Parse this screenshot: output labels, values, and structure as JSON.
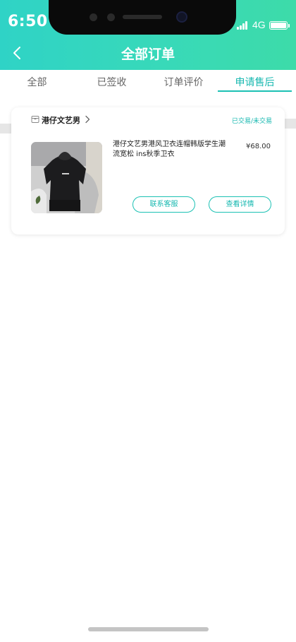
{
  "status_bar": {
    "time": "6:50",
    "network": "4G"
  },
  "header": {
    "title": "全部订单"
  },
  "tabs": [
    {
      "label": "全部",
      "active": false
    },
    {
      "label": "已签收",
      "active": false
    },
    {
      "label": "订单评价",
      "active": false
    },
    {
      "label": "申请售后",
      "active": true
    }
  ],
  "order": {
    "shop_name": "港仔文艺男",
    "trade_status": "已交易/未交易",
    "product_title": "港仔文艺男港风卫衣连帽韩版学生潮流宽松 ins秋季卫衣",
    "price": "¥68.00",
    "contact_label": "联系客服",
    "detail_label": "查看详情"
  },
  "colors": {
    "header_gradient_start": "#2fd3c6",
    "header_gradient_end": "#3ddba9",
    "accent": "#17b8b0"
  },
  "icons": {
    "back": "chevron-left-icon",
    "shop": "store-icon",
    "shop_link": "chevron-right-icon"
  }
}
